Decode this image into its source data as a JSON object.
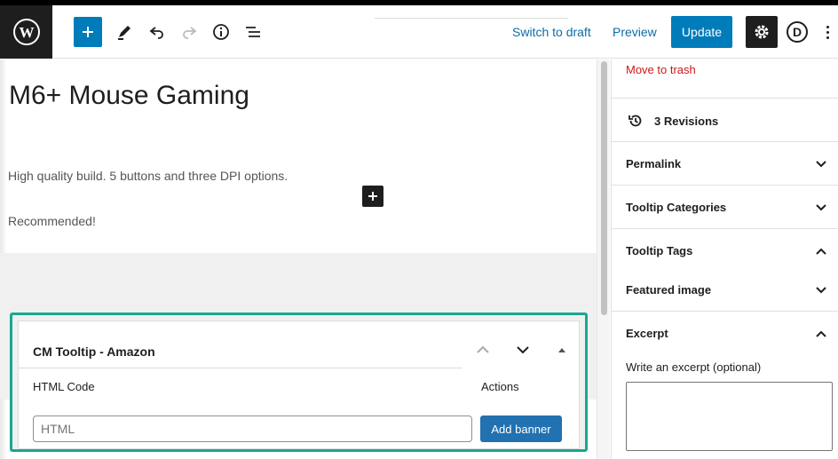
{
  "topbar": {
    "switch_to_draft": "Switch to draft",
    "preview": "Preview",
    "update": "Update",
    "avatar_letter": "D",
    "icons": [
      "wordpress-logo",
      "plus",
      "pencil",
      "undo",
      "redo",
      "info",
      "list-view",
      "gear",
      "more-vertical"
    ]
  },
  "editor": {
    "title": "M6+ Mouse Gaming",
    "paragraphs": [
      "High quality build. 5 buttons and three DPI options.",
      "Recommended!"
    ]
  },
  "metabox": {
    "title": "CM Tooltip - Amazon",
    "col_html": "HTML Code",
    "col_actions": "Actions",
    "input_placeholder": "HTML",
    "add_banner": "Add banner"
  },
  "sidebar": {
    "move_to_trash": "Move to trash",
    "revisions": "3 Revisions",
    "permalink": "Permalink",
    "tooltip_categories": "Tooltip Categories",
    "tooltip_tags": "Tooltip Tags",
    "featured_image": "Featured image",
    "excerpt": "Excerpt",
    "excerpt_hint": "Write an excerpt (optional)"
  },
  "colors": {
    "accent": "#007cba",
    "highlight_border": "#18a88f",
    "trash": "#cc1818",
    "dark": "#1e1e1e"
  }
}
